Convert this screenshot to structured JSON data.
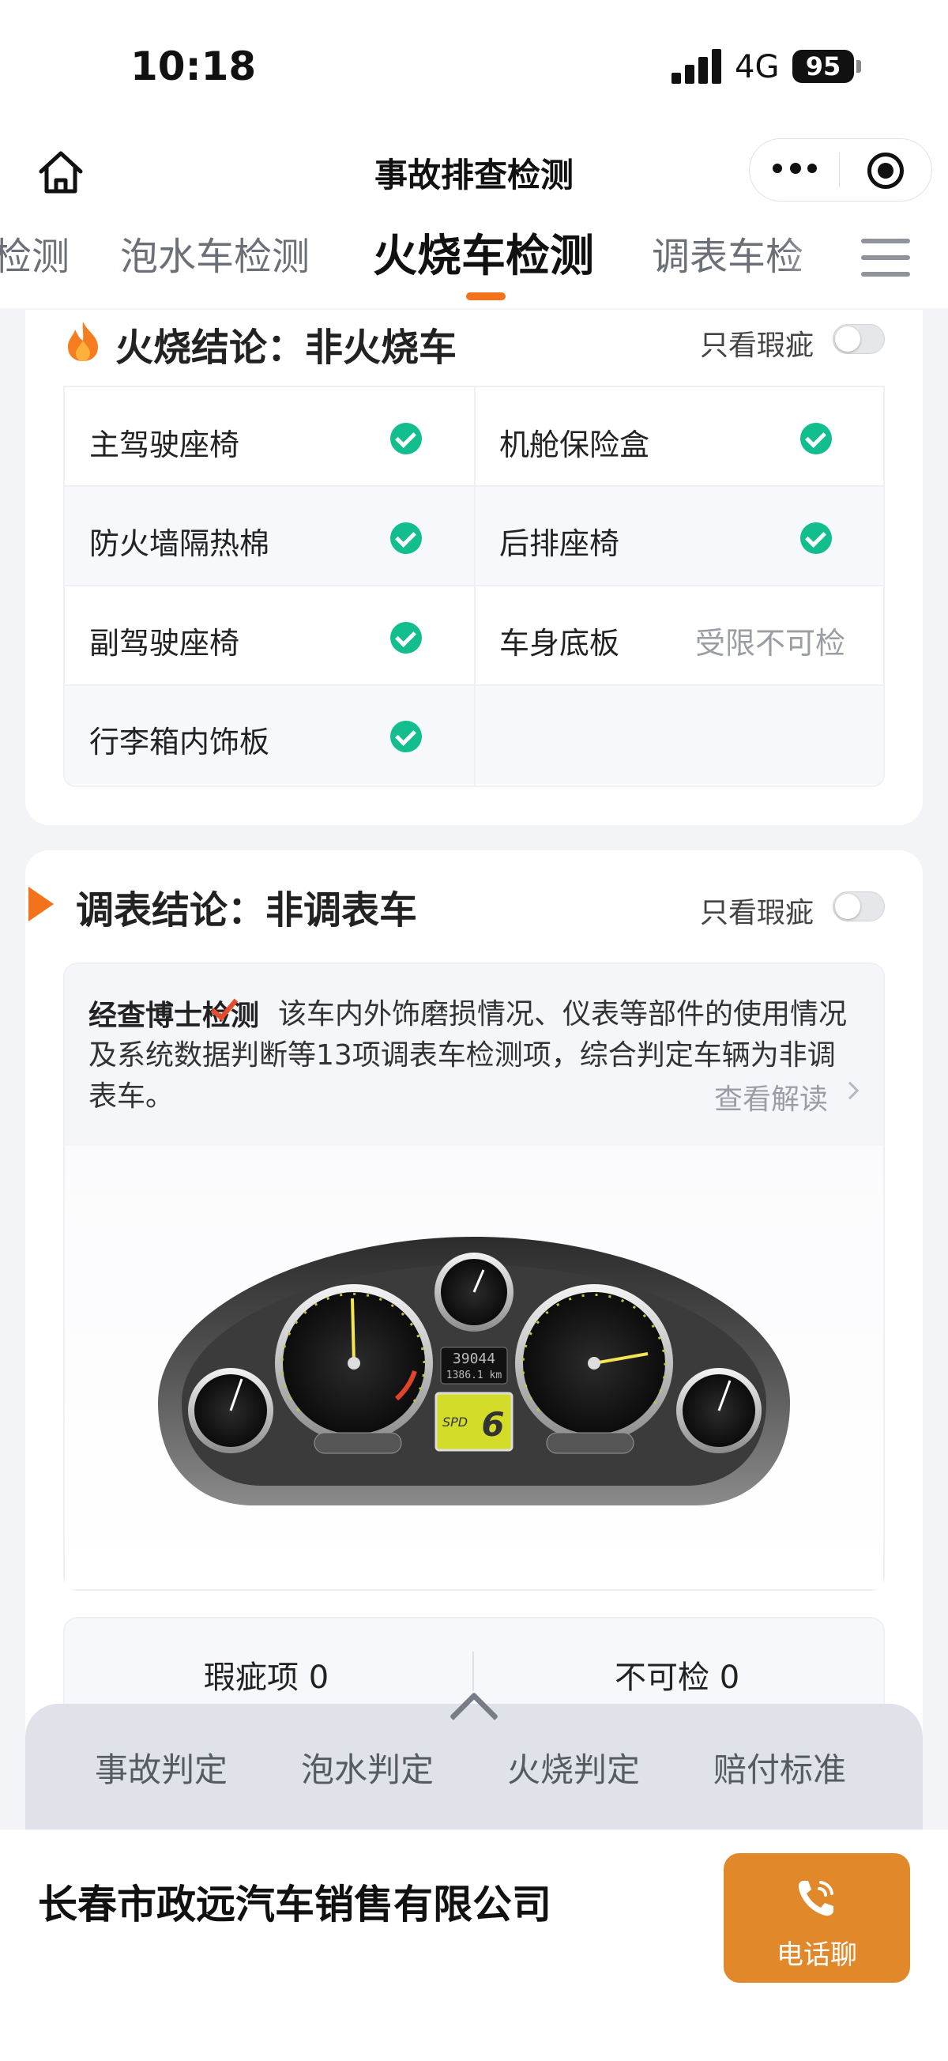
{
  "status_bar": {
    "time": "10:18",
    "network": "4G",
    "battery": "95"
  },
  "navbar": {
    "title": "事故排查检测"
  },
  "tabs": [
    "检测",
    "泡水车检测",
    "火烧车检测",
    "调表车检"
  ],
  "fire_section": {
    "title": "火烧结论：非火烧车",
    "toggle_label": "只看瑕疵",
    "items": [
      {
        "label": "主驾驶座椅",
        "status": "pass"
      },
      {
        "label": "机舱保险盒",
        "status": "pass"
      },
      {
        "label": "防火墙隔热棉",
        "status": "pass"
      },
      {
        "label": "后排座椅",
        "status": "pass"
      },
      {
        "label": "副驾驶座椅",
        "status": "pass"
      },
      {
        "label": "车身底板",
        "status": "受限不可检"
      },
      {
        "label": "行李箱内饰板",
        "status": "pass"
      }
    ]
  },
  "odometer_section": {
    "title": "调表结论：非调表车",
    "toggle_label": "只看瑕疵",
    "brand": "经查博士检测",
    "description": "该车内外饰磨损情况、仪表等部件的使用情况及系统数据判断等13项调表车检测项，综合判定车辆为非调表车。",
    "read_more": "查看解读",
    "dashboard": {
      "odometer": "39044",
      "trip": "1386.1 km",
      "gear_label": "SPD",
      "gear": "6"
    }
  },
  "summary": {
    "defects": "瑕疵项 0",
    "uncheckable": "不可检 0"
  },
  "bottom_nav": [
    "事故判定",
    "泡水判定",
    "火烧判定",
    "赔付标准"
  ],
  "footer": {
    "company": "长春市政远汽车销售有限公司",
    "call_label": "电话聊"
  },
  "colors": {
    "accent": "#f2731c",
    "check": "#12bd8e",
    "call_button": "#e0882a"
  },
  "icons": [
    "home-icon",
    "more-icon",
    "target-icon",
    "menu-icon",
    "fire-icon",
    "check-icon",
    "flag-icon",
    "chevron-right-icon",
    "chevron-up-icon",
    "phone-icon"
  ]
}
